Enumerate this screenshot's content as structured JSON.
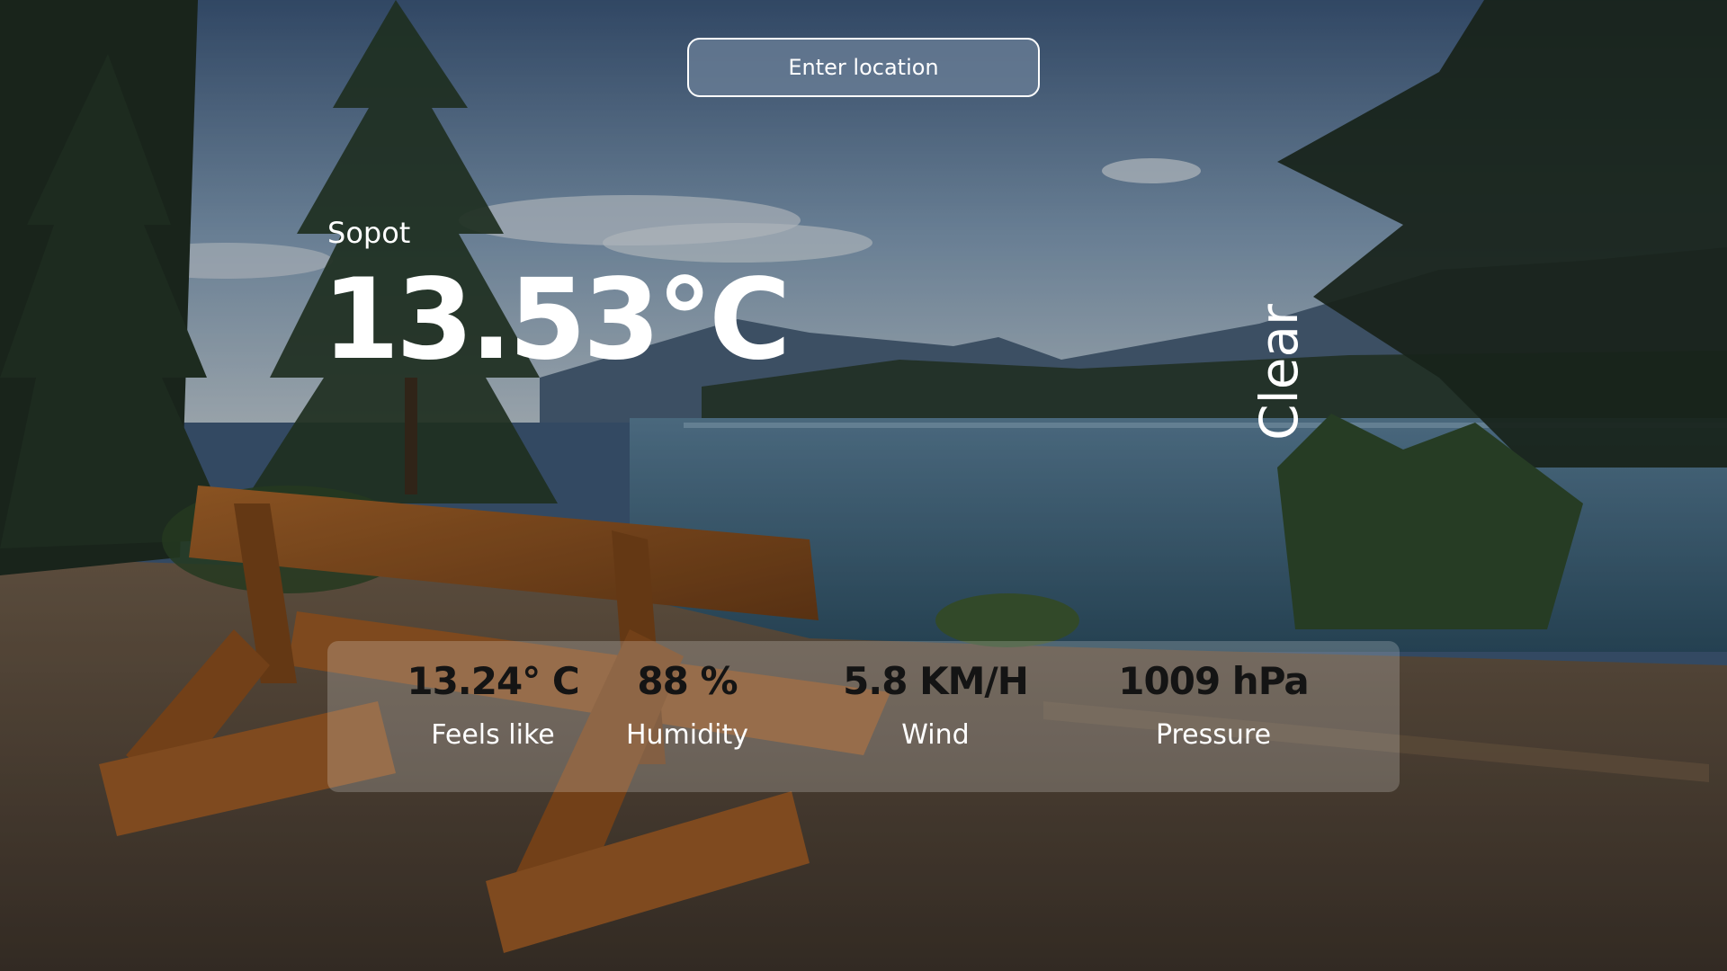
{
  "search": {
    "placeholder": "Enter location"
  },
  "weather": {
    "city": "Sopot",
    "temperature": "13.53°C",
    "condition": "Clear"
  },
  "stats": {
    "feels_like": {
      "value": "13.24° C",
      "label": "Feels like"
    },
    "humidity": {
      "value": "88 %",
      "label": "Humidity"
    },
    "wind": {
      "value": "5.8 KM/H",
      "label": "Wind"
    },
    "pressure": {
      "value": "1009 hPa",
      "label": "Pressure"
    }
  },
  "colors": {
    "text": "#ffffff",
    "stat_value": "#141414",
    "panel": "rgba(255,255,255,0.2)"
  }
}
